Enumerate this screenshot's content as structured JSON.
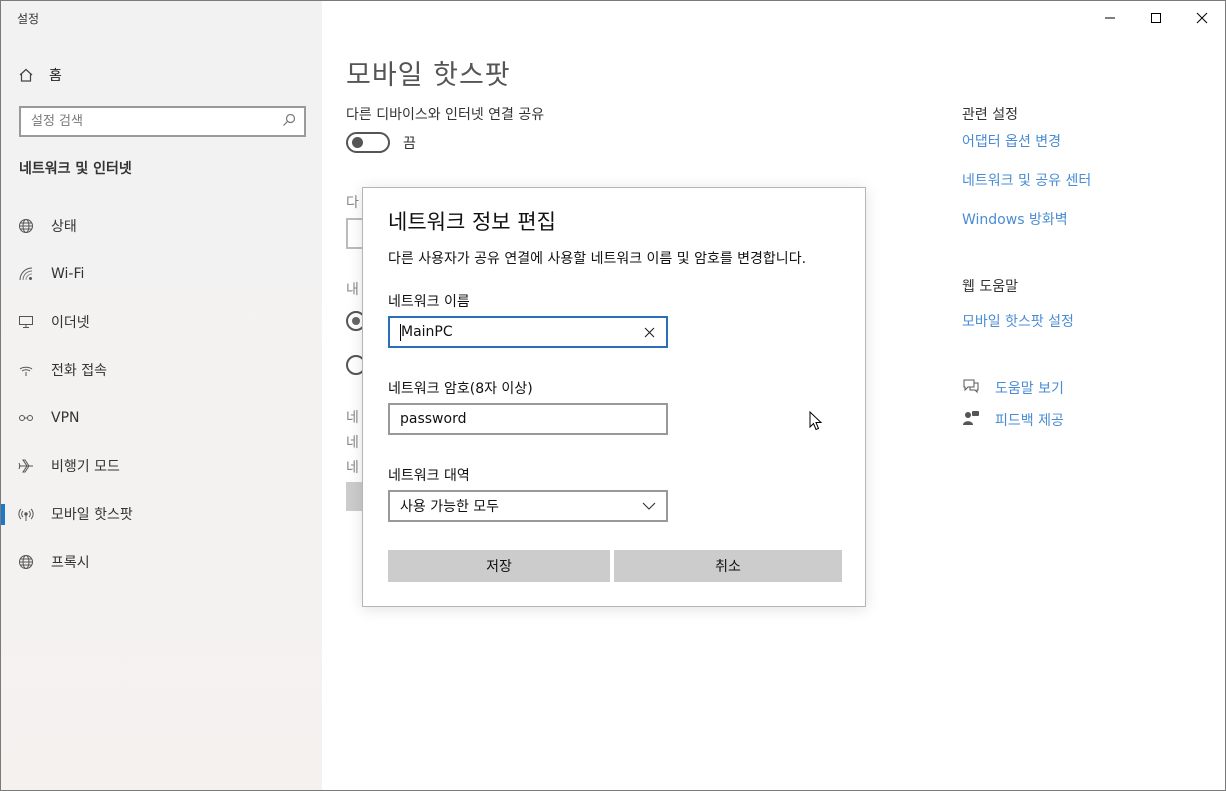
{
  "window": {
    "app_title": "설정"
  },
  "sidebar": {
    "home_label": "홈",
    "search_placeholder": "설정 검색",
    "section_title": "네트워크 및 인터넷",
    "items": [
      {
        "label": "상태",
        "icon": "globe-icon"
      },
      {
        "label": "Wi-Fi",
        "icon": "wifi-icon"
      },
      {
        "label": "이더넷",
        "icon": "ethernet-icon"
      },
      {
        "label": "전화 접속",
        "icon": "dialup-icon"
      },
      {
        "label": "VPN",
        "icon": "vpn-icon"
      },
      {
        "label": "비행기 모드",
        "icon": "airplane-icon"
      },
      {
        "label": "모바일 핫스팟",
        "icon": "hotspot-icon",
        "active": true
      },
      {
        "label": "프록시",
        "icon": "globe-icon"
      }
    ]
  },
  "main": {
    "page_title": "모바일 핫스팟",
    "share_label": "다른 디바이스와 인터넷 연결 공유",
    "toggle_state": "끔",
    "partial_texts": [
      "다",
      "내",
      "네",
      "네",
      "네"
    ]
  },
  "related": {
    "heading": "관련 설정",
    "links": [
      "어댑터 옵션 변경",
      "네트워크 및 공유 센터",
      "Windows 방화벽"
    ],
    "help_heading": "웹 도움말",
    "help_link": "모바일 핫스팟 설정",
    "get_help": "도움말 보기",
    "feedback": "피드백 제공"
  },
  "dialog": {
    "title": "네트워크 정보 편집",
    "description": "다른 사용자가 공유 연결에 사용할 네트워크 이름 및 암호를 변경합니다.",
    "name_label": "네트워크 이름",
    "name_value": "MainPC",
    "password_label": "네트워크 암호(8자 이상)",
    "password_value": "password",
    "band_label": "네트워크 대역",
    "band_value": "사용 가능한 모두",
    "save_label": "저장",
    "cancel_label": "취소"
  },
  "colors": {
    "accent": "#1e78c8",
    "link": "#4a8cd4",
    "button_bg": "#cccccc",
    "focus_border": "#2b6fb8"
  }
}
